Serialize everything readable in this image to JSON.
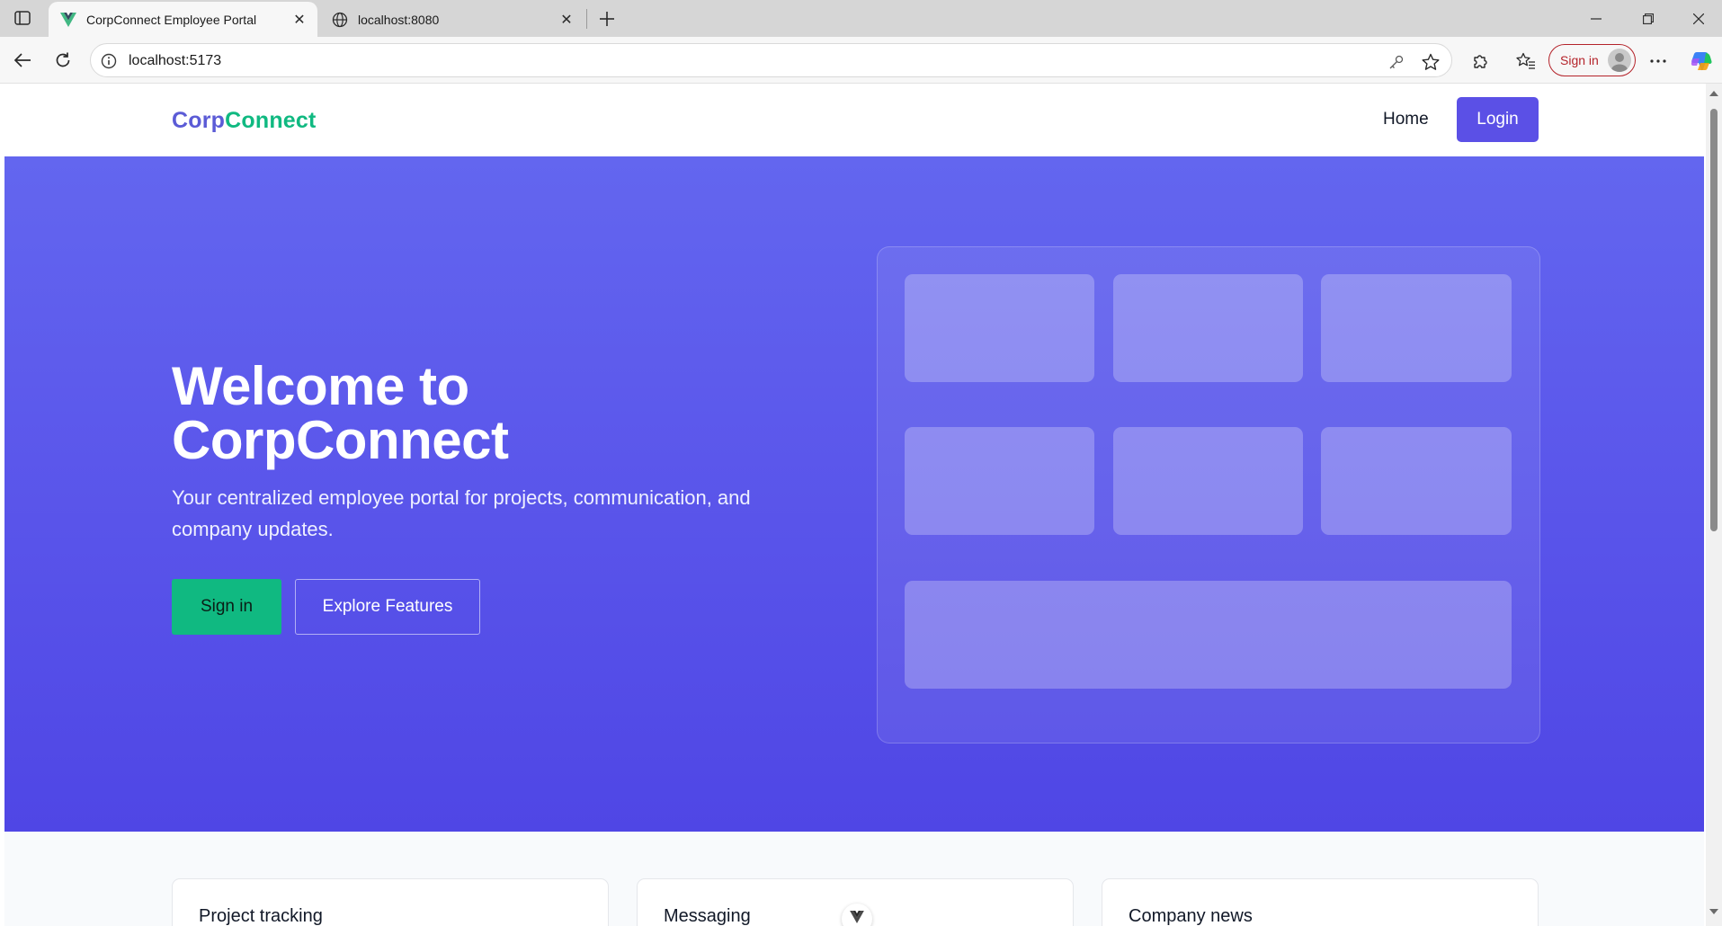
{
  "browser": {
    "tabs": [
      {
        "title": "CorpConnect Employee Portal",
        "favicon": "vue-logo-icon",
        "active": true
      },
      {
        "title": "localhost:8080",
        "favicon": "globe-icon",
        "active": false
      }
    ],
    "address_bar": {
      "url": "localhost:5173"
    },
    "profile": {
      "label": "Sign in"
    }
  },
  "site": {
    "brand": {
      "part1": "Corp",
      "part2": "Connect"
    },
    "nav": {
      "home": "Home",
      "login": "Login"
    },
    "colors": {
      "primary": "#5b50e6",
      "accent": "#10b981",
      "hero_top": "#6366ef",
      "hero_bottom": "#4f46e5"
    }
  },
  "hero": {
    "title_line1": "Welcome to",
    "title_line2": "CorpConnect",
    "subtitle": "Your centralized employee portal for projects, communication, and company updates.",
    "primary_cta": "Sign in",
    "secondary_cta": "Explore Features"
  },
  "features": {
    "cards": [
      {
        "title": "Project tracking"
      },
      {
        "title": "Messaging"
      },
      {
        "title": "Company news"
      }
    ]
  }
}
